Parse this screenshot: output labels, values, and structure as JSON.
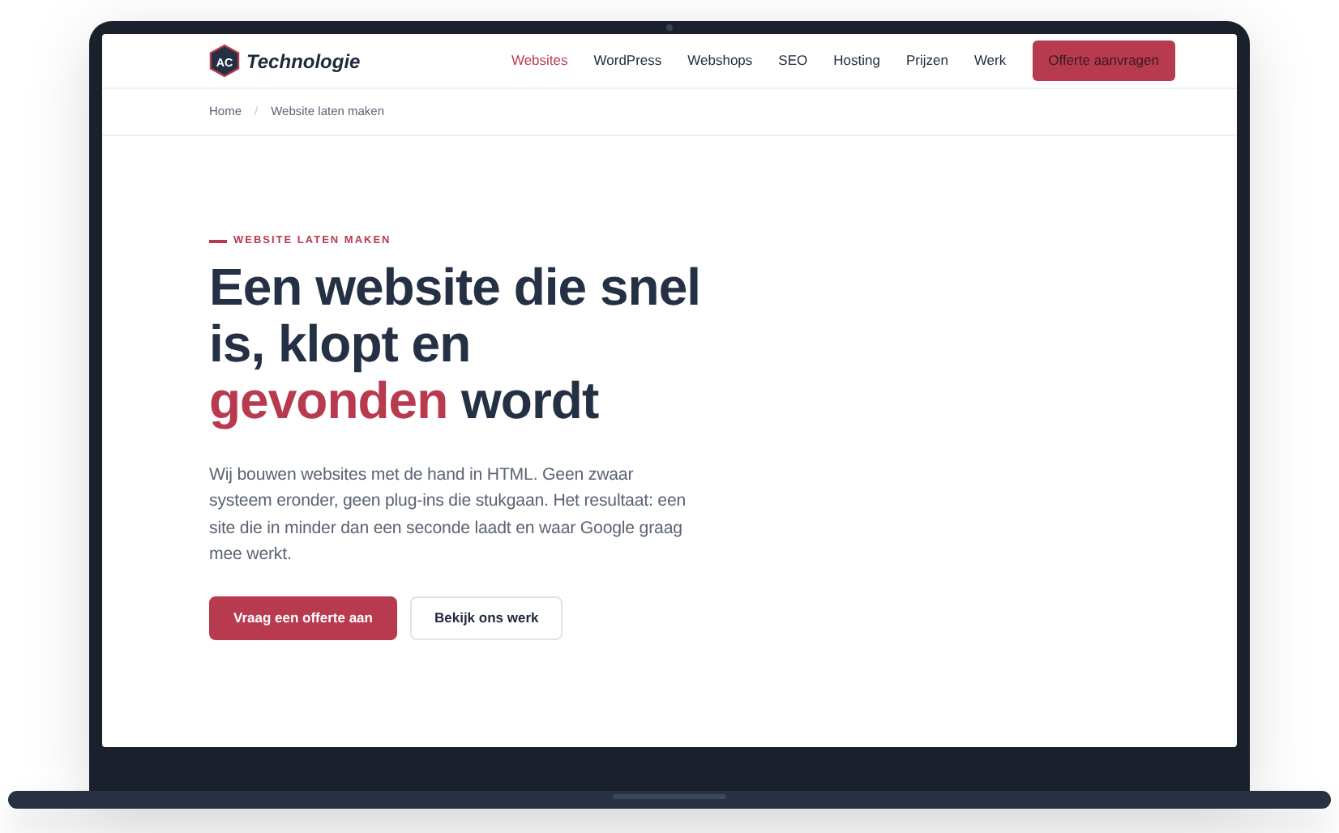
{
  "brand": {
    "badge": "AC",
    "name": "Technologie"
  },
  "nav": [
    {
      "label": "Websites",
      "selected": true
    },
    {
      "label": "WordPress",
      "selected": false
    },
    {
      "label": "Webshops",
      "selected": false
    },
    {
      "label": "SEO",
      "selected": false
    },
    {
      "label": "Hosting",
      "selected": false
    },
    {
      "label": "Prijzen",
      "selected": false
    },
    {
      "label": "Werk",
      "selected": false
    }
  ],
  "nav_button": "Offerte aanvragen",
  "breadcrumb": [
    {
      "label": "Home"
    },
    {
      "label": "Website laten maken"
    }
  ],
  "breadcrumb_separator": "/",
  "hero": {
    "eyebrow": "WEBSITE LATEN MAKEN",
    "heading": "Een website die snel is, klopt en **gevonden** wordt",
    "text": "Wij bouwen websites met de hand in HTML. Geen zwaar systeem eronder, geen plug-ins die stukgaan. Het resultaat: een site die in minder dan een seconde laadt en waar Google graag mee werkt.",
    "buttons": [
      {
        "label": "Vraag een offerte aan",
        "kind": "primary"
      },
      {
        "label": "Bekijk ons werk",
        "kind": "secondary"
      }
    ]
  }
}
